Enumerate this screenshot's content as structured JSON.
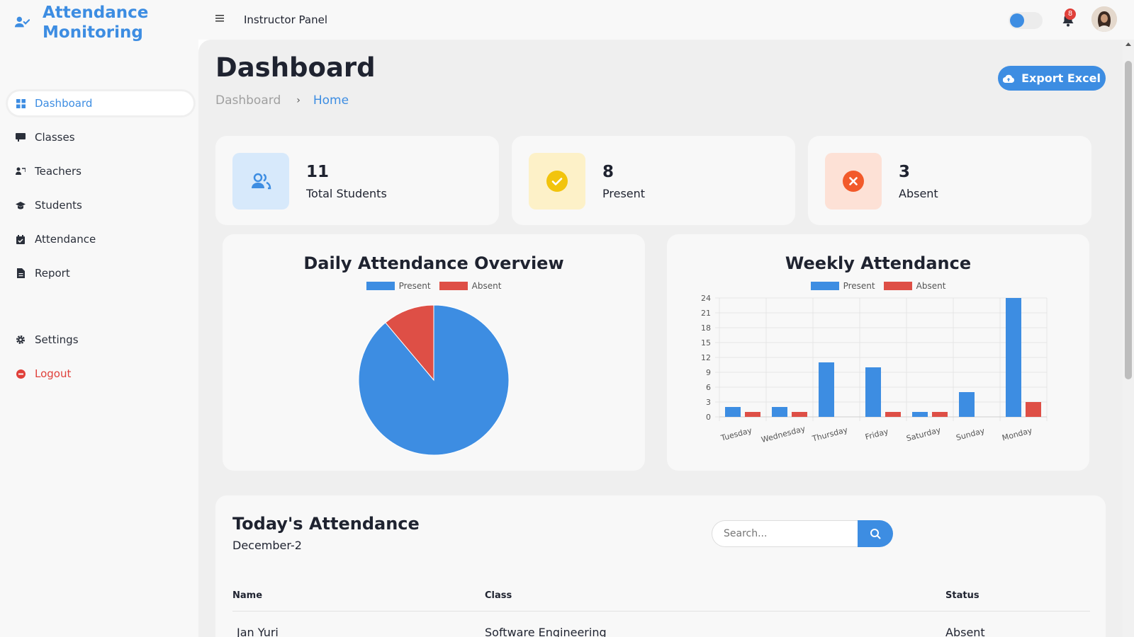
{
  "brand": {
    "title": "Attendance Monitoring",
    "icon": "user-check-icon"
  },
  "sidebar": {
    "items": [
      {
        "label": "Dashboard",
        "icon": "grid-icon",
        "active": true
      },
      {
        "label": "Classes",
        "icon": "chalkboard-icon"
      },
      {
        "label": "Teachers",
        "icon": "teacher-icon"
      },
      {
        "label": "Students",
        "icon": "graduation-cap-icon"
      },
      {
        "label": "Attendance",
        "icon": "calendar-check-icon"
      },
      {
        "label": "Report",
        "icon": "document-icon"
      }
    ],
    "bottom_items": [
      {
        "label": "Settings",
        "icon": "gear-icon"
      },
      {
        "label": "Logout",
        "icon": "logout-icon"
      }
    ]
  },
  "topbar": {
    "panel_title": "Instructor Panel",
    "notification_count": "8",
    "toggle_on": true
  },
  "page": {
    "title": "Dashboard",
    "breadcrumb": [
      "Dashboard",
      "Home"
    ],
    "export_label": "Export Excel"
  },
  "stats": [
    {
      "value": "11",
      "label": "Total Students",
      "icon": "users-icon",
      "bg": "#d7e9fb",
      "color": "#3d8de2"
    },
    {
      "value": "8",
      "label": "Present",
      "icon": "check-circle-icon",
      "bg": "#fdf1c8",
      "color": "#f2c40d"
    },
    {
      "value": "3",
      "label": "Absent",
      "icon": "x-circle-icon",
      "bg": "#fde1d6",
      "color": "#f25a2a"
    }
  ],
  "colors": {
    "accent": "#3d8de2",
    "present": "#3d8de2",
    "absent": "#de4f46"
  },
  "chart_data": [
    {
      "type": "pie",
      "title": "Daily Attendance Overview",
      "legend": [
        "Present",
        "Absent"
      ],
      "slices": [
        {
          "name": "Present",
          "value": 8
        },
        {
          "name": "Absent",
          "value": 1
        }
      ],
      "legend_position": "top"
    },
    {
      "type": "bar",
      "title": "Weekly Attendance",
      "categories": [
        "Tuesday",
        "Wednesday",
        "Thursday",
        "Friday",
        "Saturday",
        "Sunday",
        "Monday"
      ],
      "series": [
        {
          "name": "Present",
          "values": [
            2,
            2,
            11,
            10,
            1,
            5,
            24
          ]
        },
        {
          "name": "Absent",
          "values": [
            1,
            1,
            0,
            1,
            1,
            0,
            3
          ]
        }
      ],
      "ylim": [
        0,
        24
      ],
      "yticks": [
        0,
        3,
        6,
        9,
        12,
        15,
        18,
        21,
        24
      ],
      "grid": true,
      "legend_position": "top"
    }
  ],
  "attendance": {
    "title": "Today's Attendance",
    "date": "December-2",
    "search_placeholder": "Search...",
    "columns": [
      "Name",
      "Class",
      "Status"
    ],
    "rows": [
      {
        "name": "Jan Yuri",
        "class": "Software Engineering",
        "status": "Absent"
      }
    ]
  }
}
